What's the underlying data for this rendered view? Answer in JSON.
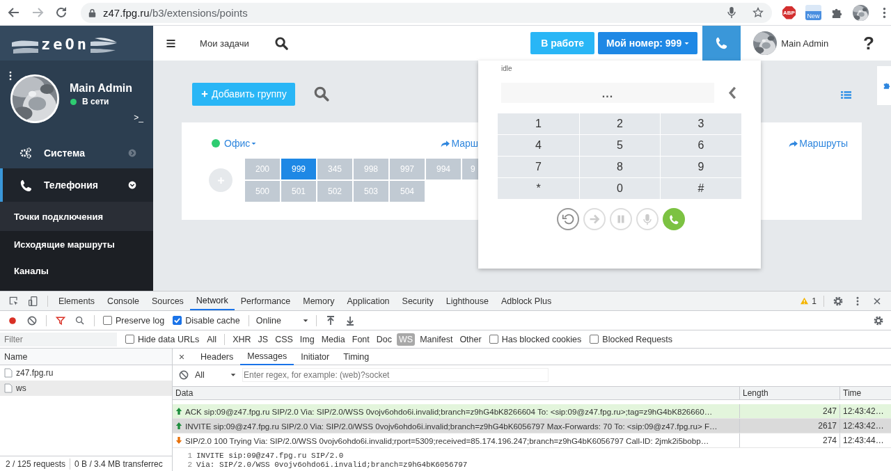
{
  "browser": {
    "url_host": "z47.fpg.ru",
    "url_path": "/b3/extensions/points",
    "extensions": [
      {
        "kind": "stop",
        "label": "ABP"
      },
      {
        "kind": "new",
        "label": "New"
      }
    ]
  },
  "sidebar": {
    "logo": "zeOn",
    "user": {
      "name": "Main Admin",
      "status": "В сети",
      "online": true
    },
    "terminal": ">_",
    "menu": [
      {
        "label": "Система",
        "kind": "system",
        "expanded": false,
        "selected": false
      },
      {
        "label": "Телефония",
        "kind": "telephony",
        "expanded": true,
        "selected": true,
        "children": [
          {
            "label": "Точки подключения",
            "selected": true
          },
          {
            "label": "Исходящие маршруты",
            "selected": false
          },
          {
            "label": "Каналы",
            "selected": false
          }
        ]
      }
    ]
  },
  "header": {
    "tasks": "Мои задачи",
    "status_button": "В работе",
    "number_button": "Мой номер: 999",
    "user_name": "Main Admin",
    "help": "?"
  },
  "content": {
    "add_button": "Добавить группу",
    "groups": [
      {
        "name": "Офис",
        "online": true,
        "routes_link": "Марш",
        "extensions": [
          {
            "number": "200",
            "selected": false,
            "kind": "full"
          },
          {
            "number": "999",
            "selected": true,
            "kind": "full"
          },
          {
            "number": "345",
            "selected": false,
            "kind": "full"
          },
          {
            "number": "998",
            "selected": false,
            "kind": "full"
          },
          {
            "number": "997",
            "selected": false,
            "kind": "full"
          },
          {
            "number": "994",
            "selected": false,
            "kind": "full"
          },
          {
            "number": "9",
            "selected": false,
            "kind": "partial"
          },
          {
            "number": "500",
            "selected": false,
            "kind": "full"
          },
          {
            "number": "501",
            "selected": false,
            "kind": "full"
          },
          {
            "number": "502",
            "selected": false,
            "kind": "full"
          },
          {
            "number": "503",
            "selected": false,
            "kind": "full"
          },
          {
            "number": "504",
            "selected": false,
            "kind": "full"
          }
        ]
      },
      {
        "routes_link": "Маршруты"
      }
    ]
  },
  "dialer": {
    "state": "idle",
    "display": "...",
    "keys": [
      "1",
      "2",
      "3",
      "4",
      "5",
      "6",
      "7",
      "8",
      "9",
      "*",
      "0",
      "#"
    ],
    "actions": [
      {
        "kind": "redial",
        "enabled": true
      },
      {
        "kind": "transfer",
        "enabled": false
      },
      {
        "kind": "hold",
        "enabled": false
      },
      {
        "kind": "mute",
        "enabled": false
      },
      {
        "kind": "call",
        "enabled": true
      }
    ]
  },
  "devtools": {
    "tabs": [
      {
        "label": "Elements",
        "selected": false
      },
      {
        "label": "Console",
        "selected": false
      },
      {
        "label": "Sources",
        "selected": false
      },
      {
        "label": "Network",
        "selected": true
      },
      {
        "label": "Performance",
        "selected": false
      },
      {
        "label": "Memory",
        "selected": false
      },
      {
        "label": "Application",
        "selected": false
      },
      {
        "label": "Security",
        "selected": false
      },
      {
        "label": "Lighthouse",
        "selected": false
      },
      {
        "label": "Adblock Plus",
        "selected": false
      }
    ],
    "warnings": "1",
    "preserve_log": {
      "label": "Preserve log",
      "checked": false
    },
    "disable_cache": {
      "label": "Disable cache",
      "checked": true
    },
    "throttle": "Online",
    "filter": {
      "placeholder": "Filter",
      "hide_data_urls": {
        "label": "Hide data URLs",
        "checked": false
      },
      "types": [
        {
          "label": "All",
          "selected": false
        },
        {
          "label": "XHR",
          "selected": false
        },
        {
          "label": "JS",
          "selected": false
        },
        {
          "label": "CSS",
          "selected": false
        },
        {
          "label": "Img",
          "selected": false
        },
        {
          "label": "Media",
          "selected": false
        },
        {
          "label": "Font",
          "selected": false
        },
        {
          "label": "Doc",
          "selected": false
        },
        {
          "label": "WS",
          "selected": true
        },
        {
          "label": "Manifest",
          "selected": false
        },
        {
          "label": "Other",
          "selected": false
        }
      ],
      "has_blocked_cookies": {
        "label": "Has blocked cookies",
        "checked": false
      },
      "blocked_requests": {
        "label": "Blocked Requests",
        "checked": false
      }
    },
    "requests": {
      "column": "Name",
      "rows": [
        {
          "name": "z47.fpg.ru",
          "selected": false
        },
        {
          "name": "ws",
          "selected": true
        }
      ],
      "summary": "2 / 125 requests",
      "transferred": "0 B / 3.4 MB transferrec"
    },
    "detail": {
      "tabs": [
        {
          "label": "Headers",
          "selected": false
        },
        {
          "label": "Messages",
          "selected": true
        },
        {
          "label": "Initiator",
          "selected": false
        },
        {
          "label": "Timing",
          "selected": false
        }
      ],
      "message_filter": "All",
      "regex_placeholder": "Enter regex, for example: (web)?socket",
      "columns": [
        "Data",
        "Length",
        "Time"
      ],
      "messages": [
        {
          "kind": "sent",
          "selected": false,
          "data": "ACK sip:09@z47.fpg.ru SIP/2.0 Via: SIP/2.0/WSS 0vojv6ohdo6i.invalid;branch=z9hG4bK8266604 To: <sip:09@z47.fpg.ru>;tag=z9hG4bK826660…",
          "length": "247",
          "time": "12:43:42…"
        },
        {
          "kind": "sent",
          "selected": true,
          "data": "INVITE sip:09@z47.fpg.ru SIP/2.0 Via: SIP/2.0/WSS 0vojv6ohdo6i.invalid;branch=z9hG4bK6056797 Max-Forwards: 70 To: <sip:09@z47.fpg.ru> F…",
          "length": "2617",
          "time": "12:43:42…"
        },
        {
          "kind": "received",
          "selected": false,
          "data": "SIP/2.0 100 Trying Via: SIP/2.0/WSS 0vojv6ohdo6i.invalid;rport=5309;received=85.174.196.247;branch=z9hG4bK6056797 Call-ID: 2jmk2i5bobp…",
          "length": "274",
          "time": "12:43:44…"
        }
      ],
      "code": [
        {
          "line": "1",
          "text": "INVITE sip:09@z47.fpg.ru SIP/2.0"
        },
        {
          "line": "2",
          "text": "Via: SIP/2.0/WSS 0vojv6ohdo6i.invalid;branch=z9hG4bK6056797"
        }
      ]
    }
  }
}
